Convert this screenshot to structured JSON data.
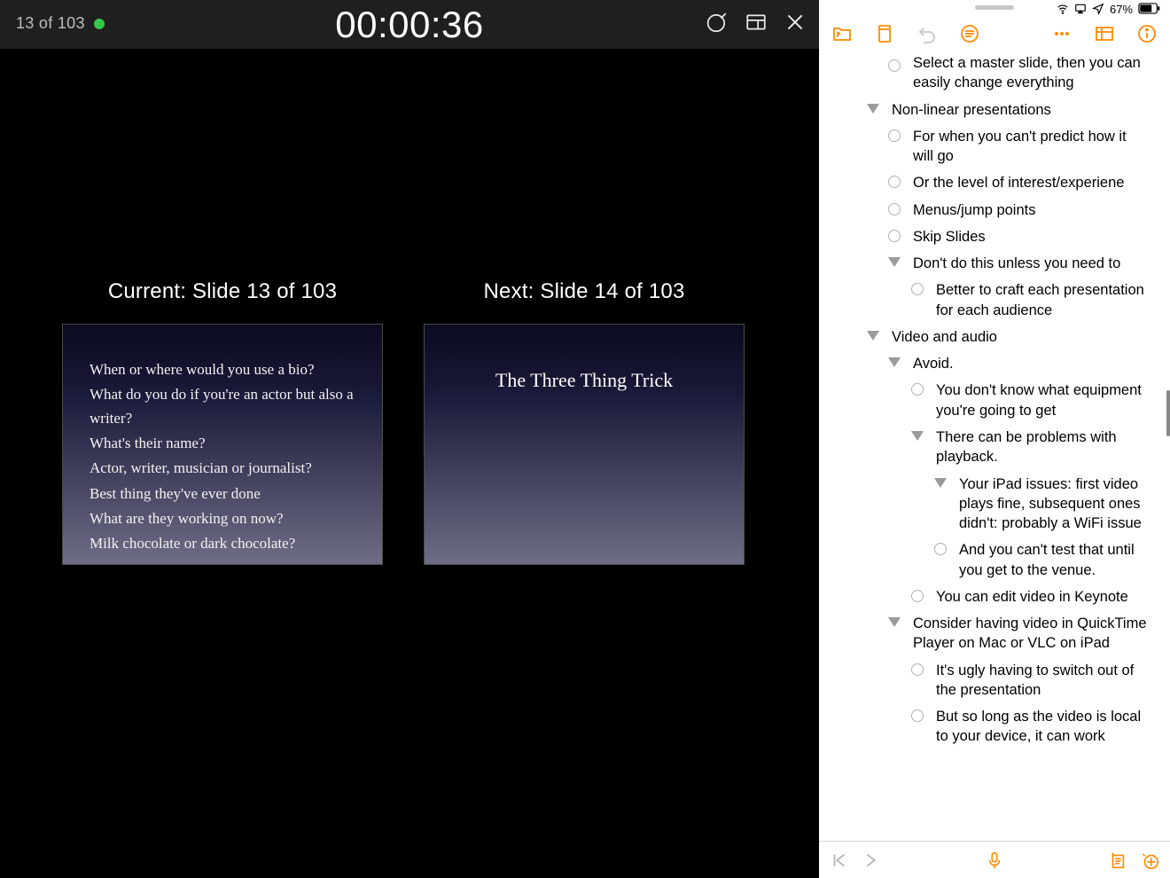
{
  "presenter": {
    "counter": "13 of 103",
    "timer": "00:00:36",
    "current_label": "Current: Slide 13 of 103",
    "next_label": "Next: Slide 14 of 103",
    "current_lines": [
      "When or where would you use a bio?",
      "What do you do if you're an actor but also a writer?",
      "What's their name?",
      "Actor, writer, musician or journalist?",
      "Best thing they've ever done",
      "What are they working on now?",
      "Milk chocolate or dark chocolate?"
    ],
    "next_title": "The Three Thing Trick"
  },
  "status": {
    "battery": "67%"
  },
  "outline": [
    {
      "indent": 2,
      "marker": "bullet",
      "text": "Select a master slide, then you can easily change everything",
      "cut": true
    },
    {
      "indent": 1,
      "marker": "disclosure",
      "text": "Non-linear presentations"
    },
    {
      "indent": 2,
      "marker": "bullet",
      "text": "For when you can't predict how it will go"
    },
    {
      "indent": 2,
      "marker": "bullet",
      "text": "Or the level of interest/experiene"
    },
    {
      "indent": 2,
      "marker": "bullet",
      "text": "Menus/jump points"
    },
    {
      "indent": 2,
      "marker": "bullet",
      "text": "Skip Slides"
    },
    {
      "indent": 2,
      "marker": "disclosure",
      "text": "Don't do this unless you need to"
    },
    {
      "indent": 3,
      "marker": "bullet",
      "text": "Better to craft each presentation for each audience"
    },
    {
      "indent": 1,
      "marker": "disclosure",
      "text": "Video and audio"
    },
    {
      "indent": 2,
      "marker": "disclosure",
      "text": "Avoid."
    },
    {
      "indent": 3,
      "marker": "bullet",
      "text": "You don't know what equipment you're going to get"
    },
    {
      "indent": 3,
      "marker": "disclosure",
      "text": "There can be problems with playback."
    },
    {
      "indent": 4,
      "marker": "disclosure",
      "text": "Your iPad issues: first video plays fine, subsequent ones didn't: probably a WiFi issue"
    },
    {
      "indent": 4,
      "marker": "bullet",
      "text": "And you can't test that until you get to the venue."
    },
    {
      "indent": 3,
      "marker": "bullet",
      "text": "You can edit video in Keynote"
    },
    {
      "indent": 2,
      "marker": "disclosure",
      "text": "Consider having video in QuickTime Player on Mac or VLC on iPad"
    },
    {
      "indent": 3,
      "marker": "bullet",
      "text": "It's ugly having to switch out of the presentation"
    },
    {
      "indent": 3,
      "marker": "bullet",
      "text": "But so long as the video is local to your device, it can work"
    }
  ]
}
